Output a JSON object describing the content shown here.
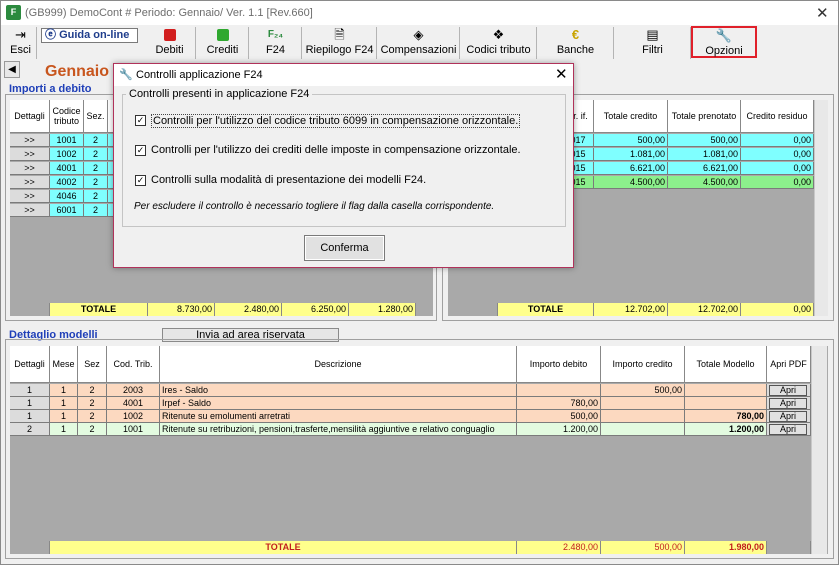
{
  "window": {
    "title": "(GB999) DemoCont  # Periodo: Gennaio/  Ver. 1.1 [Rev.660]"
  },
  "toolbar": {
    "esci": "Esci",
    "guida": "Guida on-line",
    "items": [
      "Debiti",
      "Crediti",
      "F24",
      "Riepilogo F24",
      "Compensazioni",
      "Codici tributo",
      "Banche",
      "Filtri",
      "Opzioni"
    ]
  },
  "period_title": "Gennaio",
  "debito": {
    "section_label": "Importi a debito",
    "headers": [
      "Dettagli",
      "Codice tributo",
      "Sez."
    ],
    "rows": [
      {
        "btn": ">>",
        "code": "1001",
        "sez": "2"
      },
      {
        "btn": ">>",
        "code": "1002",
        "sez": "2"
      },
      {
        "btn": ">>",
        "code": "4001",
        "sez": "2"
      },
      {
        "btn": ">>",
        "code": "4002",
        "sez": "2"
      },
      {
        "btn": ">>",
        "code": "4046",
        "sez": "2"
      },
      {
        "btn": ">>",
        "code": "6001",
        "sez": "2"
      }
    ],
    "totals": {
      "label": "TOTALE",
      "v1": "8.730,00",
      "v2": "2.480,00",
      "v3": "6.250,00",
      "v4": "1.280,00"
    }
  },
  "credito": {
    "headers": [
      "er. if.",
      "Totale credito",
      "Totale prenotato",
      "Credito residuo"
    ],
    "rows": [
      {
        "anno": "017",
        "totale": "500,00",
        "prenotato": "500,00",
        "residuo": "0,00",
        "color": "cyan"
      },
      {
        "anno": "015",
        "totale": "1.081,00",
        "prenotato": "1.081,00",
        "residuo": "0,00",
        "color": "cyan"
      },
      {
        "anno": "015",
        "totale": "6.621,00",
        "prenotato": "6.621,00",
        "residuo": "0,00",
        "color": "cyan"
      },
      {
        "anno": "015",
        "totale": "4.500,00",
        "prenotato": "4.500,00",
        "residuo": "0,00",
        "color": "green"
      }
    ],
    "totals": {
      "label": "TOTALE",
      "totale": "12.702,00",
      "prenotato": "12.702,00",
      "residuo": "0,00"
    }
  },
  "modelli": {
    "section_label": "Dettaglio modelli",
    "invia_label": "Invia ad area riservata",
    "headers": [
      "Dettagli",
      "Mese",
      "Sez",
      "Cod. Trib.",
      "Descrizione",
      "Importo debito",
      "Importo credito",
      "Totale Modello",
      "Apri PDF"
    ],
    "rows": [
      {
        "det": "1",
        "mese": "1",
        "sez": "2",
        "cod": "2003",
        "desc": "Ires - Saldo",
        "debito": "",
        "credito": "500,00",
        "totale": "",
        "apri": "Apri",
        "color": "peach"
      },
      {
        "det": "1",
        "mese": "1",
        "sez": "2",
        "cod": "4001",
        "desc": "Irpef - Saldo",
        "debito": "780,00",
        "credito": "",
        "totale": "",
        "apri": "Apri",
        "color": "peach"
      },
      {
        "det": "1",
        "mese": "1",
        "sez": "2",
        "cod": "1002",
        "desc": "Ritenute su emolumenti arretrati",
        "debito": "500,00",
        "credito": "",
        "totale": "780,00",
        "apri": "Apri",
        "color": "peach"
      },
      {
        "det": "2",
        "mese": "1",
        "sez": "2",
        "cod": "1001",
        "desc": "Ritenute su retribuzioni, pensioni,trasferte,mensilità aggiuntive e relativo conguaglio",
        "debito": "1.200,00",
        "credito": "",
        "totale": "1.200,00",
        "apri": "Apri",
        "color": "lgreen"
      }
    ],
    "totals": {
      "label": "TOTALE",
      "debito": "2.480,00",
      "credito": "500,00",
      "totale": "1.980,00"
    }
  },
  "dialog": {
    "title": "Controlli applicazione F24",
    "group_label": "Controlli presenti in applicazione F24",
    "checks": [
      {
        "label": "Controlli per l'utilizzo del codice tributo 6099 in compensazione orizzontale.",
        "checked": "✓"
      },
      {
        "label": "Controlli per l'utilizzo dei crediti delle imposte in compensazione orizzontale.",
        "checked": "✓"
      },
      {
        "label": "Controlli sulla modalità di presentazione dei modelli F24.",
        "checked": "✓"
      }
    ],
    "note": "Per escludere il controllo è necessario togliere il flag dalla casella corrispondente.",
    "confirm_label": "Conferma"
  },
  "colors": {
    "accent_red": "#e0202a",
    "section_blue": "#1f3fb8",
    "title_orange": "#c8561e",
    "cyan_row": "#7fffff",
    "green_row": "#8cf08c",
    "peach_row": "#fcd9c0",
    "total_yellow": "#ffff8c"
  }
}
